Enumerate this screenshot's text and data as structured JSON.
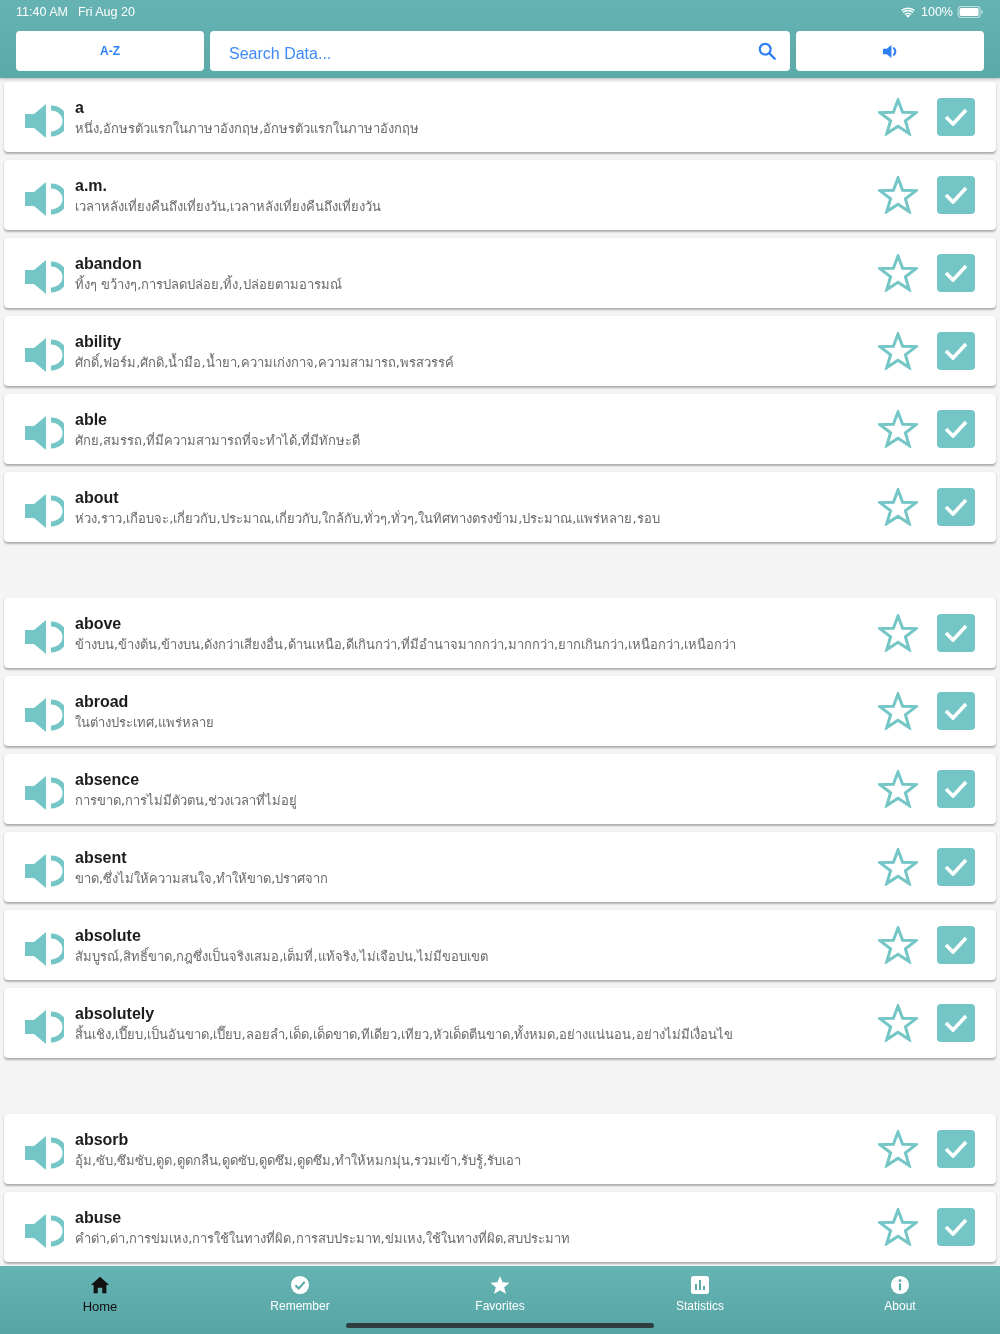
{
  "status_bar": {
    "time": "11:40 AM",
    "date": "Fri Aug 20",
    "battery": "100%"
  },
  "toolbar": {
    "sort_button": "A-Z",
    "search": {
      "placeholder": "Search Data..."
    }
  },
  "sections": [
    {
      "entries": [
        {
          "word": "a",
          "meaning": "หนึ่ง,อักษรตัวแรกในภาษาอังกฤษ,อักษรตัวแรกในภาษาอังกฤษ",
          "favorite": false,
          "checked": true
        },
        {
          "word": "a.m.",
          "meaning": "เวลาหลังเที่ยงคืนถึงเที่ยงวัน,เวลาหลังเที่ยงคืนถึงเที่ยงวัน",
          "favorite": false,
          "checked": true
        },
        {
          "word": "abandon",
          "meaning": "ทิ้งๆ ขว้างๆ,การปลดปล่อย,ทิ้ง,ปล่อยตามอารมณ์",
          "favorite": false,
          "checked": true
        },
        {
          "word": "ability",
          "meaning": "ศักดิ์,ฟอร์ม,ศักดิ,น้ำมือ,น้ำยา,ความเก่งกาจ,ความสามารถ,พรสวรรค์",
          "favorite": false,
          "checked": true
        },
        {
          "word": "able",
          "meaning": "ศักย,สมรรถ,ที่มีความสามารถที่จะทำได้,ที่มีทักษะดี",
          "favorite": false,
          "checked": true
        },
        {
          "word": "about",
          "meaning": "ห่วง,ราว,เกือบจะ,เกี่ยวกับ,ประมาณ,เกี่ยวกับ,ใกล้กับ,ทั่วๆ,ทั่วๆ,ในทิศทางตรงข้าม,ประมาณ,แพร่หลาย,รอบ",
          "favorite": false,
          "checked": true
        }
      ]
    },
    {
      "entries": [
        {
          "word": "above",
          "meaning": "ข้างบน,ข้างต้น,ข้างบน,ดังกว่าเสียงอื่น,ด้านเหนือ,ดีเกินกว่า,ที่มีอำนาจมากกว่า,มากกว่า,ยากเกินกว่า,เหนือกว่า,เหนือกว่า",
          "favorite": false,
          "checked": true
        },
        {
          "word": "abroad",
          "meaning": "ในต่างประเทศ,แพร่หลาย",
          "favorite": false,
          "checked": true
        },
        {
          "word": "absence",
          "meaning": "การขาด,การไม่มีตัวตน,ช่วงเวลาที่ไม่อยู่",
          "favorite": false,
          "checked": true
        },
        {
          "word": "absent",
          "meaning": "ขาด,ซึ่งไม่ให้ความสนใจ,ทำให้ขาด,ปราศจาก",
          "favorite": false,
          "checked": true
        },
        {
          "word": "absolute",
          "meaning": "สัมบูรณ์,สิทธิ์ขาด,กฎซึ่งเป็นจริงเสมอ,เต็มที่,แท้จริง,ไม่เจือปน,ไม่มีขอบเขต",
          "favorite": false,
          "checked": true
        },
        {
          "word": "absolutely",
          "meaning": "สิ้นเชิง,เปี๊ยบ,เป็นอันขาด,เปี๊ยบ,ลอยลำ,เด็ด,เด็ดขาด,ทีเดียว,เทียว,หัวเด็ดตีนขาด,ทั้งหมด,อย่างแน่นอน,อย่างไม่มีเงื่อนไข",
          "favorite": false,
          "checked": true
        }
      ]
    },
    {
      "entries": [
        {
          "word": "absorb",
          "meaning": "อุ้ม,ซับ,ซึมซับ,ดูด,ดูดกลืน,ดูดซับ,ดูดซึม,ดูดซึม,ทำให้หมกมุ่น,รวมเข้า,รับรู้,รับเอา",
          "favorite": false,
          "checked": true
        },
        {
          "word": "abuse",
          "meaning": "คำด่า,ด่า,การข่มเหง,การใช้ในทางที่ผิด,การสบประมาท,ข่มเหง,ใช้ในทางที่ผิด,สบประมาท",
          "favorite": false,
          "checked": true
        }
      ]
    }
  ],
  "tab_bar": [
    {
      "label": "Home",
      "selected": true
    },
    {
      "label": "Remember",
      "selected": false
    },
    {
      "label": "Favorites",
      "selected": false
    },
    {
      "label": "Statistics",
      "selected": false
    },
    {
      "label": "About",
      "selected": false
    }
  ]
}
